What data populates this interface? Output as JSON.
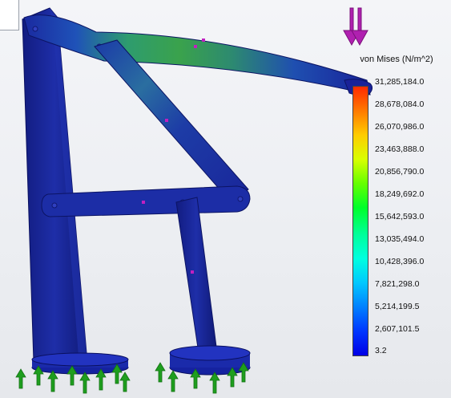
{
  "legend": {
    "title": "von Mises (N/m^2)",
    "ticks": [
      "31,285,184.0",
      "28,678,084.0",
      "26,070,986.0",
      "23,463,888.0",
      "20,856,790.0",
      "18,249,692.0",
      "15,642,593.0",
      "13,035,494.0",
      "10,428,396.0",
      "7,821,298.0",
      "5,214,199.5",
      "2,607,101.5",
      "3.2"
    ]
  },
  "colors": {
    "part_blue": "#1a2a9a",
    "fixture_green": "#1e9e1e",
    "load_magenta": "#c020c0",
    "stress_max": "#ff2a00",
    "stress_min": "#0000e6"
  },
  "icons": {
    "load": "downward-force-arrows-icon",
    "fixture": "fixed-geometry-arrows-icon"
  }
}
